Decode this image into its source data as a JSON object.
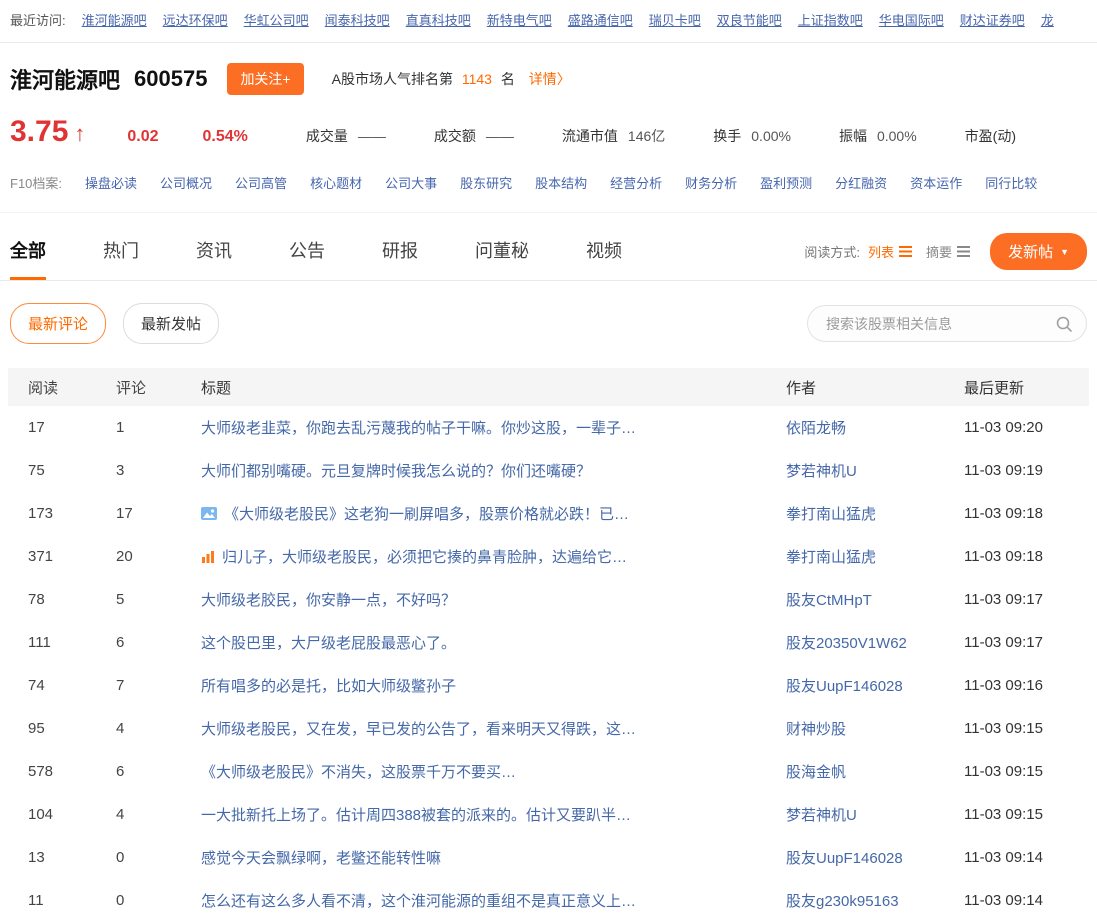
{
  "accent": {
    "orange": "#ff6a00",
    "red": "#e03434",
    "blue": "#4666ae"
  },
  "recent_visits": {
    "label": "最近访问:",
    "links": [
      "淮河能源吧",
      "远达环保吧",
      "华虹公司吧",
      "闻泰科技吧",
      "直真科技吧",
      "新特电气吧",
      "盛路通信吧",
      "瑞贝卡吧",
      "双良节能吧",
      "上证指数吧",
      "华电国际吧",
      "财达证券吧",
      "龙"
    ]
  },
  "header": {
    "title": "淮河能源吧",
    "code": "600575",
    "follow_button": "加关注+",
    "rank_prefix": "A股市场人气排名第",
    "rank_value": "1143",
    "rank_suffix": "名",
    "rank_detail": "详情〉"
  },
  "quote": {
    "price": "3.75",
    "arrow": "↑",
    "change": "0.02",
    "change_pct": "0.54%",
    "fields": [
      {
        "label": "成交量",
        "value": "——"
      },
      {
        "label": "成交额",
        "value": "——"
      },
      {
        "label": "流通市值",
        "value": "146亿"
      },
      {
        "label": "换手",
        "value": "0.00%"
      },
      {
        "label": "振幅",
        "value": "0.00%"
      },
      {
        "label": "市盈(动)",
        "value": ""
      }
    ]
  },
  "f10": {
    "label": "F10档案:",
    "links": [
      "操盘必读",
      "公司概况",
      "公司高管",
      "核心题材",
      "公司大事",
      "股东研究",
      "股本结构",
      "经营分析",
      "财务分析",
      "盈利预测",
      "分红融资",
      "资本运作",
      "同行比较"
    ]
  },
  "tabs": {
    "items": [
      {
        "key": "all",
        "label": "全部",
        "active": true
      },
      {
        "key": "hot",
        "label": "热门",
        "active": false
      },
      {
        "key": "news",
        "label": "资讯",
        "active": false
      },
      {
        "key": "announcements",
        "label": "公告",
        "active": false
      },
      {
        "key": "reports",
        "label": "研报",
        "active": false
      },
      {
        "key": "ask-secretary",
        "label": "问董秘",
        "active": false
      },
      {
        "key": "video",
        "label": "视频",
        "active": false
      }
    ],
    "read_mode_label": "阅读方式:",
    "read_mode_list": "列表",
    "read_mode_digest": "摘要",
    "new_post_button": "发新帖",
    "new_post_caret": "▼"
  },
  "filters": {
    "latest_comments": "最新评论",
    "latest_posts": "最新发帖",
    "search_placeholder": "搜索该股票相关信息"
  },
  "table": {
    "headers": [
      "阅读",
      "评论",
      "标题",
      "作者",
      "最后更新"
    ],
    "rows": [
      {
        "reads": "17",
        "comments": "1",
        "icon": "",
        "title": "大师级老韭菜，你跑去乱污蔑我的帖子干嘛。你炒这股，一辈子…",
        "author": "依陌龙畅",
        "updated": "11-03 09:20"
      },
      {
        "reads": "75",
        "comments": "3",
        "icon": "",
        "title": "大师们都别嘴硬。元旦复牌时候我怎么说的？你们还嘴硬？",
        "author": "梦若神机U",
        "updated": "11-03 09:19"
      },
      {
        "reads": "173",
        "comments": "17",
        "icon": "image-icon",
        "title": "《大师级老股民》这老狗一刷屏唱多，股票价格就必跌！已…",
        "author": "拳打南山猛虎",
        "updated": "11-03 09:18"
      },
      {
        "reads": "371",
        "comments": "20",
        "icon": "chart-icon",
        "title": "归儿子，大师级老股民，必须把它揍的鼻青脸肿，达遍给它…",
        "author": "拳打南山猛虎",
        "updated": "11-03 09:18"
      },
      {
        "reads": "78",
        "comments": "5",
        "icon": "",
        "title": "大师级老胶民，你安静一点，不好吗？",
        "author": "股友CtMHpT",
        "updated": "11-03 09:17"
      },
      {
        "reads": "111",
        "comments": "6",
        "icon": "",
        "title": "这个股巴里，大尸级老屁股最恶心了。",
        "author": "股友20350V1W62",
        "updated": "11-03 09:17"
      },
      {
        "reads": "74",
        "comments": "7",
        "icon": "",
        "title": "所有唱多的必是托，比如大师级鳖孙子",
        "author": "股友UupF146028",
        "updated": "11-03 09:16"
      },
      {
        "reads": "95",
        "comments": "4",
        "icon": "",
        "title": "大师级老股民，又在发，早已发的公告了，看来明天又得跌，这…",
        "author": "财神炒股",
        "updated": "11-03 09:15"
      },
      {
        "reads": "578",
        "comments": "6",
        "icon": "",
        "title": "《大师级老股民》不消失，这股票千万不要买…",
        "author": "股海金帆",
        "updated": "11-03 09:15"
      },
      {
        "reads": "104",
        "comments": "4",
        "icon": "",
        "title": "一大批新托上场了。估计周四388被套的派来的。估计又要趴半…",
        "author": "梦若神机U",
        "updated": "11-03 09:15"
      },
      {
        "reads": "13",
        "comments": "0",
        "icon": "",
        "title": "感觉今天会飘绿啊，老鳖还能转性嘛",
        "author": "股友UupF146028",
        "updated": "11-03 09:14"
      },
      {
        "reads": "11",
        "comments": "0",
        "icon": "",
        "title": "怎么还有这么多人看不清，这个淮河能源的重组不是真正意义上…",
        "author": "股友g230k95163",
        "updated": "11-03 09:14"
      }
    ]
  }
}
